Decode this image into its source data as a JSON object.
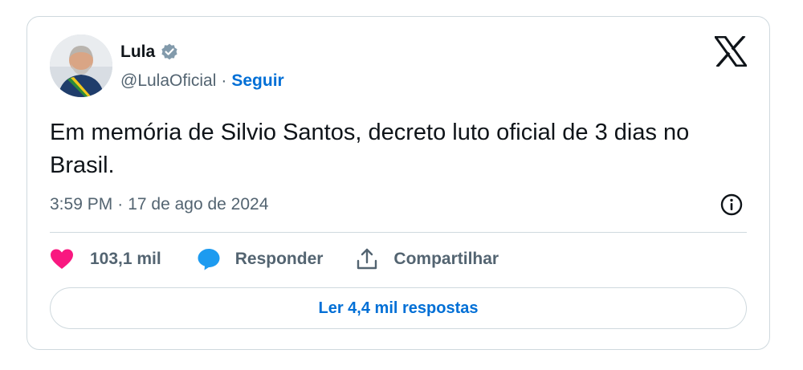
{
  "author": {
    "display_name": "Lula",
    "handle": "@LulaOficial",
    "separator": "·",
    "follow_label": "Seguir",
    "avatar_icon": "profile-photo",
    "verified_icon": "verified-badge-icon",
    "verified_color": "#829aab"
  },
  "platform": {
    "logo_icon": "x-logo-icon"
  },
  "tweet": {
    "text": "Em memória de Silvio Santos, decreto luto oficial de 3 dias no Brasil.",
    "time": "3:59 PM",
    "separator": "·",
    "date": "17 de ago de 2024",
    "info_icon": "info-icon"
  },
  "actions": {
    "likes_label": "103,1 mil",
    "reply_label": "Responder",
    "share_label": "Compartilhar",
    "like_icon": "heart-icon",
    "reply_icon": "chat-bubble-icon",
    "share_icon": "share-upload-icon",
    "like_color": "#f91880",
    "reply_color": "#1d9bf0"
  },
  "replies_button": {
    "label": "Ler 4,4 mil respostas"
  },
  "colors": {
    "link_blue": "#006fd6",
    "secondary_text": "#536471",
    "primary_text": "#0f1419",
    "border": "#cfd9de"
  }
}
